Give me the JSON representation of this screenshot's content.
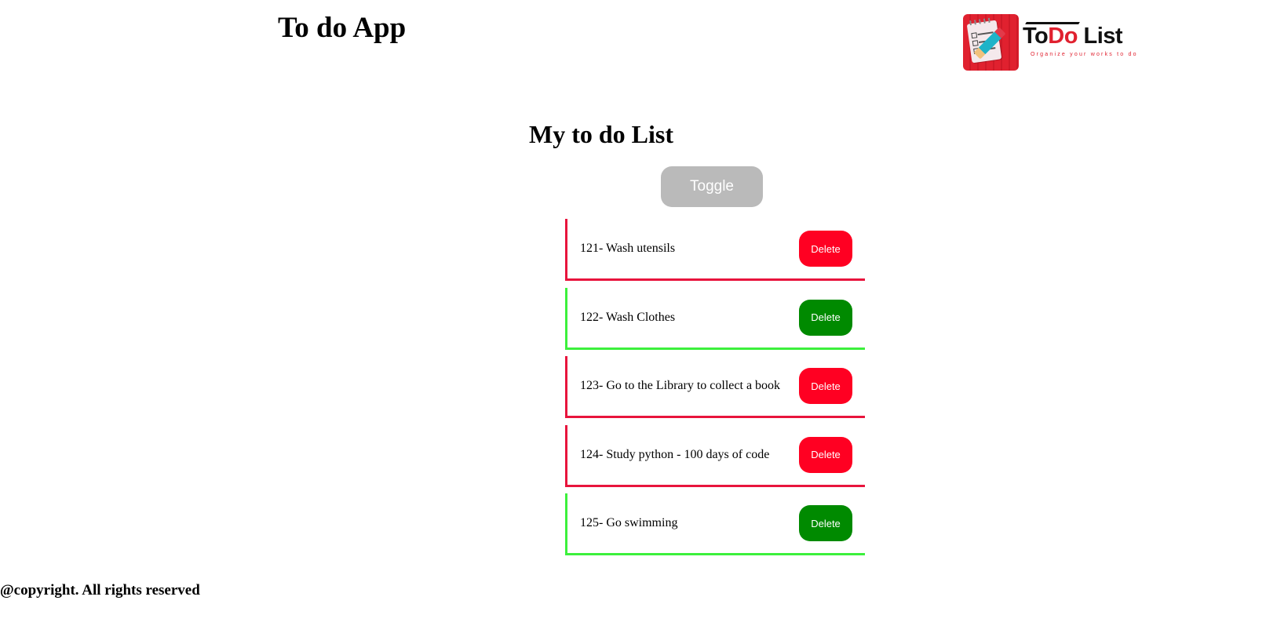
{
  "header": {
    "title": "To do App",
    "logo": {
      "word1": "To",
      "word2": "Do",
      "word3": " List",
      "tagline": "Organize your works to do",
      "icon": "notepad-pencil-icon"
    }
  },
  "main": {
    "title": "My to do List",
    "toggle_label": "Toggle",
    "todos": [
      {
        "text": "121- Wash utensils",
        "delete_label": "Delete",
        "status": "pending"
      },
      {
        "text": "122- Wash Clothes",
        "delete_label": "Delete",
        "status": "done"
      },
      {
        "text": "123- Go to the Library to collect a book",
        "delete_label": "Delete",
        "status": "pending"
      },
      {
        "text": "124- Study python - 100 days of code",
        "delete_label": "Delete",
        "status": "pending"
      },
      {
        "text": "125- Go swimming",
        "delete_label": "Delete",
        "status": "done"
      }
    ]
  },
  "colors": {
    "pending_border": "#e8143c",
    "done_border": "#3cf03c",
    "pending_button": "#ff0022",
    "done_button": "#008a00",
    "toggle_button": "#bababa"
  },
  "footer": {
    "text": "@copyright. All rights reserved"
  }
}
